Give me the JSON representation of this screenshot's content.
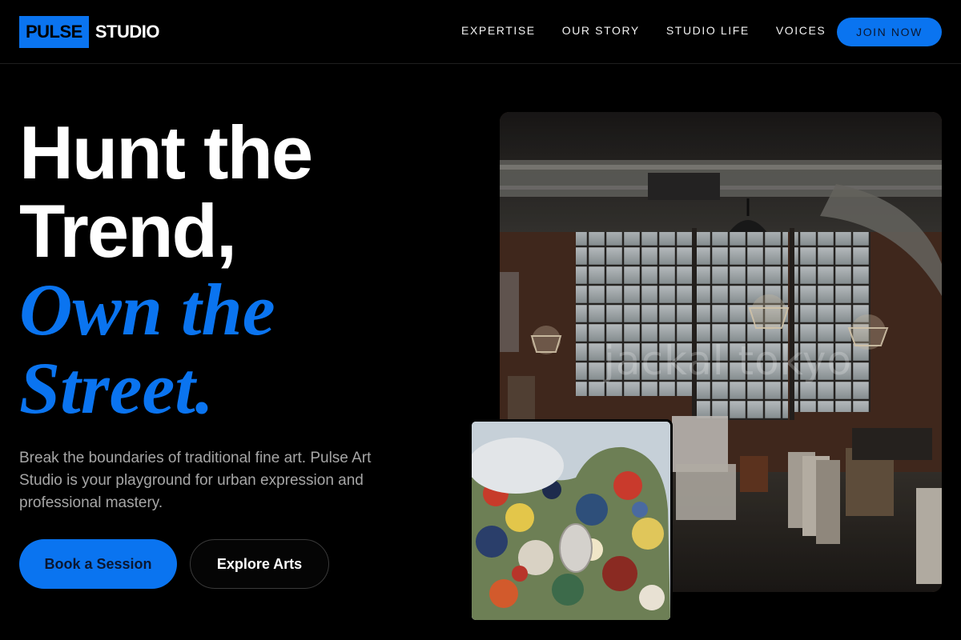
{
  "brand": {
    "mark": "PULSE",
    "name": "STUDIO"
  },
  "nav": {
    "links": [
      "EXPERTISE",
      "OUR STORY",
      "STUDIO LIFE",
      "VOICES"
    ],
    "cta": "JOIN NOW"
  },
  "hero": {
    "headline_line1": "Hunt the",
    "headline_line2": "Trend,",
    "headline_line3": "Own the",
    "headline_line4": "Street.",
    "description": "Break the boundaries of traditional fine art. Pulse Art Studio is your playground for urban expression and professional mastery.",
    "primary_button": "Book a Session",
    "secondary_button": "Explore Arts"
  },
  "images": {
    "studio_watermark": "jackal tokyo"
  },
  "colors": {
    "accent": "#0a74f0",
    "background": "#000000",
    "text": "#ffffff",
    "muted_text": "#a6a6a6"
  }
}
